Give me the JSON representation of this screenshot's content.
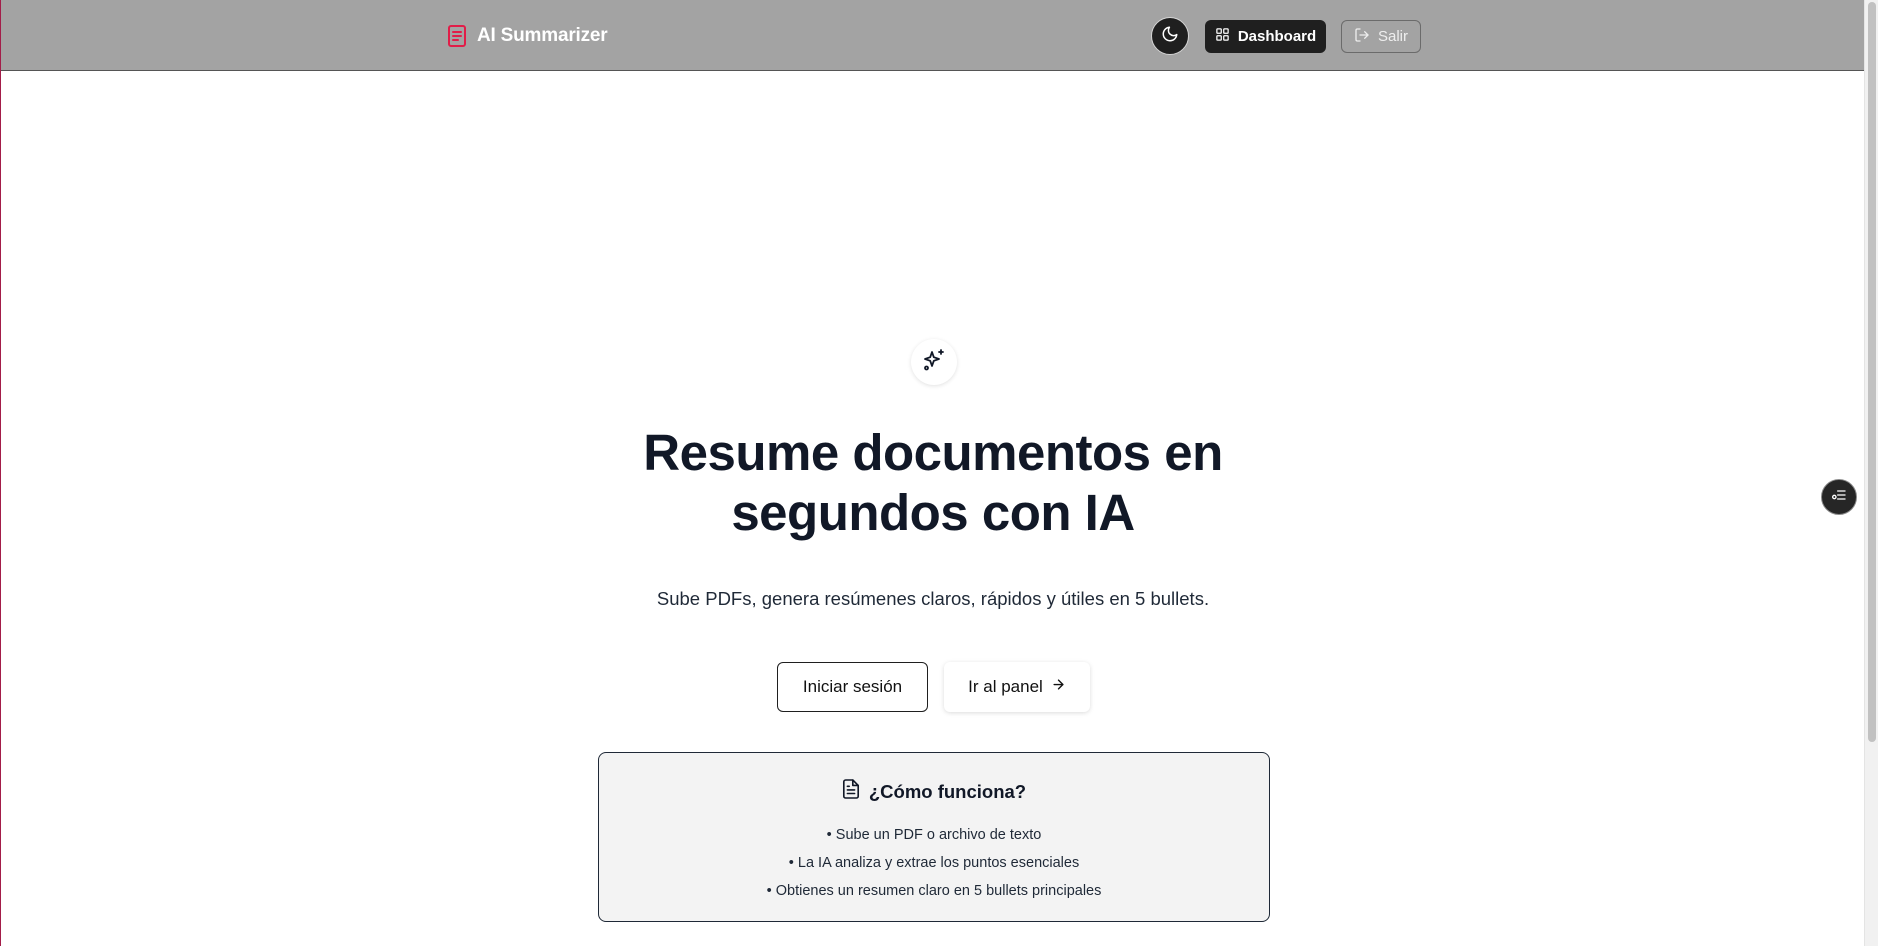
{
  "header": {
    "brand_title": "AI Summarizer",
    "brand_icon": "document-icon",
    "theme_toggle_icon": "moon-icon",
    "dashboard_label": "Dashboard",
    "dashboard_icon": "grid-icon",
    "logout_label": "Salir",
    "logout_icon": "logout-icon"
  },
  "hero": {
    "icon": "sparkles-icon",
    "title_line1": "Resume documentos en",
    "title_line2": "segundos con IA",
    "subtitle": "Sube PDFs, genera resúmenes claros, rápidos y útiles en 5 bullets.",
    "login_label": "Iniciar sesión",
    "panel_label": "Ir al panel",
    "panel_icon": "arrow-right-icon"
  },
  "how_it_works": {
    "icon": "file-text-icon",
    "title": "¿Cómo funciona?",
    "steps": [
      "• Sube un PDF o archivo de texto",
      "• La IA analiza y extrae los puntos esenciales",
      "• Obtienes un resumen claro en 5 bullets principales"
    ]
  },
  "side_fab": {
    "icon": "list-filter-icon"
  },
  "colors": {
    "header_bg": "#a3a3a3",
    "brand_accent": "#e11d48",
    "dark_button": "#1f1f1f",
    "card_bg": "#f3f3f3",
    "text_primary": "#111827"
  }
}
